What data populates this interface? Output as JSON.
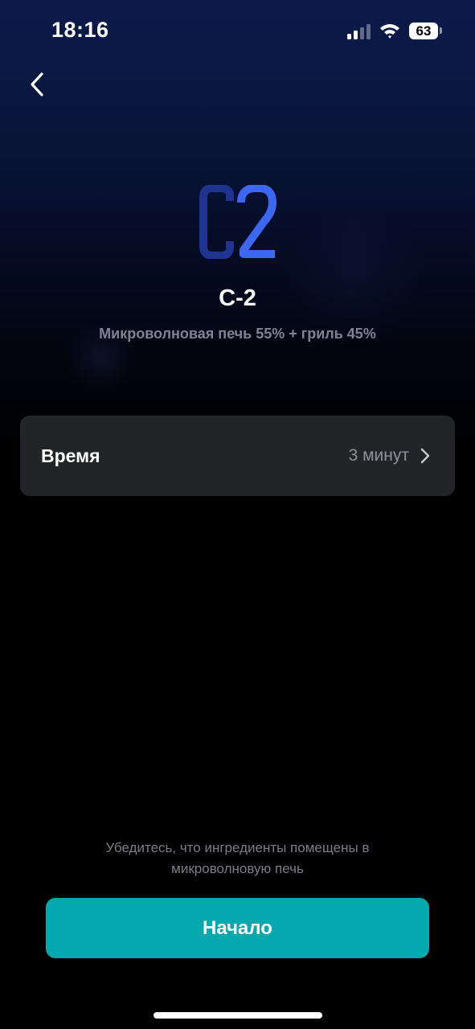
{
  "status_bar": {
    "time": "18:16",
    "battery_level": "63",
    "signal_bars_active": 2,
    "signal_bars_total": 4,
    "icons": [
      "signal-icon",
      "wifi-icon",
      "battery-icon"
    ]
  },
  "header": {
    "back_icon": "chevron-left-icon"
  },
  "program": {
    "logo_text": "C2",
    "logo_colors": {
      "c": "#1e3490",
      "two": "#3c67f0"
    },
    "title": "C-2",
    "subtitle": "Микроволновая печь 55% + гриль 45%"
  },
  "settings": {
    "time_row": {
      "label": "Время",
      "value": "3 минут",
      "icon": "chevron-right-icon"
    }
  },
  "footer": {
    "hint": "Убедитесь, что ингредиенты помещены в микроволновую печь",
    "start_label": "Начало"
  },
  "colors": {
    "accent": "#03a9ae",
    "card": "#232427",
    "background_top": "#0b1a4b",
    "background_bottom": "#000000"
  }
}
